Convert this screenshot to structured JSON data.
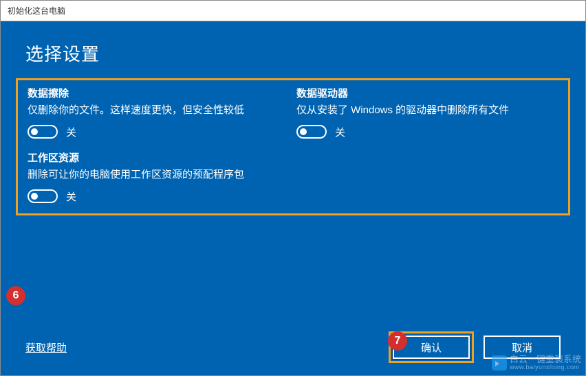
{
  "window_title": "初始化这台电脑",
  "page_title": "选择设置",
  "settings": {
    "data_erase": {
      "title": "数据擦除",
      "desc": "仅删除你的文件。这样速度更快，但安全性较低",
      "toggle_label": "关"
    },
    "data_drive": {
      "title": "数据驱动器",
      "desc": "仅从安装了 Windows 的驱动器中删除所有文件",
      "toggle_label": "关"
    },
    "workspace": {
      "title": "工作区资源",
      "desc": "删除可让你的电脑使用工作区资源的预配程序包",
      "toggle_label": "关"
    }
  },
  "help_link": "获取帮助",
  "buttons": {
    "confirm": "确认",
    "cancel": "取消"
  },
  "annotations": {
    "badge6": "6",
    "badge7": "7"
  },
  "watermark": {
    "main": "白云一键重装系统",
    "sub": "www.baiyunxitong.com"
  }
}
